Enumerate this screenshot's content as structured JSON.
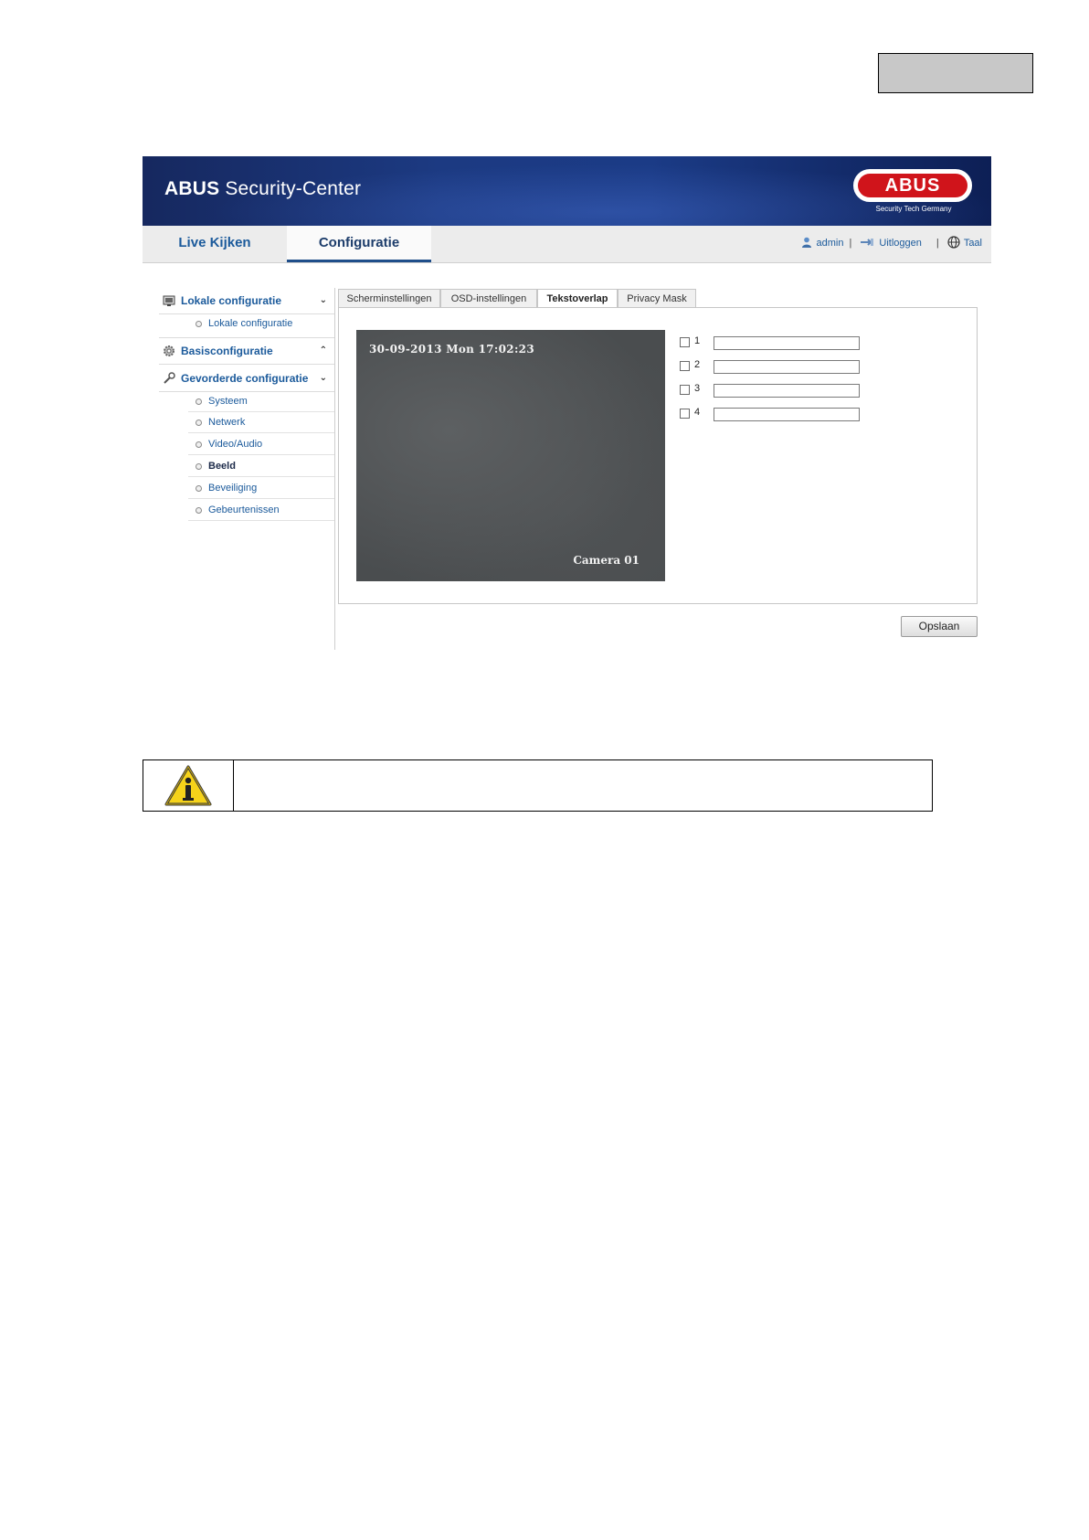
{
  "header": {
    "brand_bold": "ABUS",
    "brand_rest": " Security-Center",
    "logo_text": "ABUS",
    "logo_sub": "Security Tech Germany"
  },
  "nav": {
    "tab_live": "Live Kijken",
    "tab_config": "Configuratie",
    "user": "admin",
    "logout": "Uitloggen",
    "language": "Taal",
    "separator": "|"
  },
  "sidebar": {
    "lokale": {
      "label": "Lokale configuratie",
      "chevron": "⌄"
    },
    "lokale_sub": "Lokale configuratie",
    "basis": {
      "label": "Basisconfiguratie",
      "chevron": "⌃"
    },
    "gevorderd": {
      "label": "Gevorderde configuratie",
      "chevron": "⌄"
    },
    "items": [
      "Systeem",
      "Netwerk",
      "Video/Audio",
      "Beeld",
      "Beveiliging",
      "Gebeurtenissen"
    ],
    "active_item": "Beeld"
  },
  "tabs": [
    "Scherminstellingen",
    "OSD-instellingen",
    "Tekstoverlap",
    "Privacy Mask"
  ],
  "active_tab": "Tekstoverlap",
  "video": {
    "date_overlay": "30-09-2013 Mon 17:02:23",
    "camera_name": "Camera 01"
  },
  "overlay_rows": [
    {
      "number": "1",
      "checked": false,
      "value": ""
    },
    {
      "number": "2",
      "checked": false,
      "value": ""
    },
    {
      "number": "3",
      "checked": false,
      "value": ""
    },
    {
      "number": "4",
      "checked": false,
      "value": ""
    }
  ],
  "save_label": "Opslaan",
  "colors": {
    "brand_blue": "#1b5a9b",
    "banner": "#1c3a82",
    "logo_red": "#d0141b"
  },
  "icons": {
    "info": "warning-info-icon",
    "user": "user-icon",
    "logout": "logout-icon",
    "language": "globe-icon"
  }
}
